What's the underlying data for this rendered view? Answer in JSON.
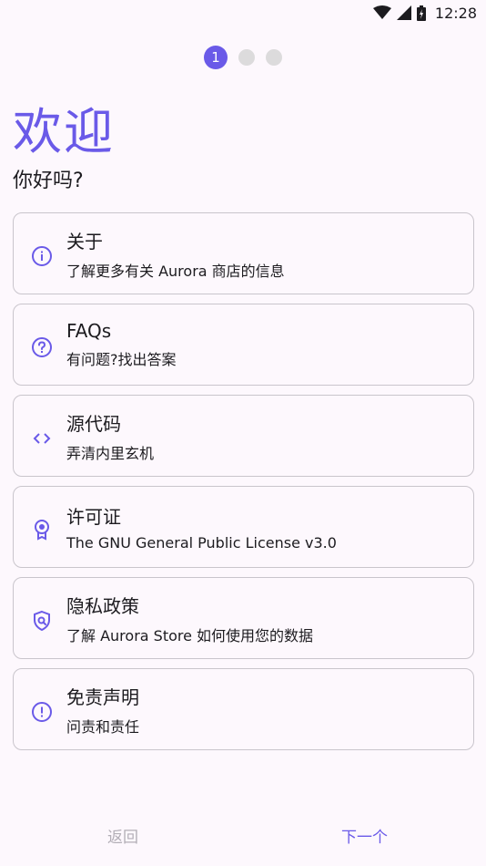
{
  "status_bar": {
    "time": "12:28",
    "icons": [
      "wifi-icon",
      "signal-icon",
      "battery-icon"
    ]
  },
  "pager": {
    "current": "1",
    "total": 3
  },
  "header": {
    "title": "欢迎",
    "subtitle": "你好吗?"
  },
  "cards": [
    {
      "icon": "info-icon",
      "title": "关于",
      "desc": "了解更多有关 Aurora 商店的信息"
    },
    {
      "icon": "help-icon",
      "title": "FAQs",
      "desc": "有问题?找出答案"
    },
    {
      "icon": "code-icon",
      "title": "源代码",
      "desc": "弄清内里玄机"
    },
    {
      "icon": "license-icon",
      "title": "许可证",
      "desc": "The GNU General Public License v3.0"
    },
    {
      "icon": "privacy-shield-icon",
      "title": "隐私政策",
      "desc": "了解 Aurora Store 如何使用您的数据"
    },
    {
      "icon": "warning-icon",
      "title": "免责声明",
      "desc": "问责和责任"
    }
  ],
  "footer": {
    "back_label": "返回",
    "next_label": "下一个"
  },
  "colors": {
    "accent": "#6a5ae8",
    "background": "#fdf8fd",
    "card_border": "#c9c5cc",
    "disabled_text": "#b2aeb6"
  }
}
